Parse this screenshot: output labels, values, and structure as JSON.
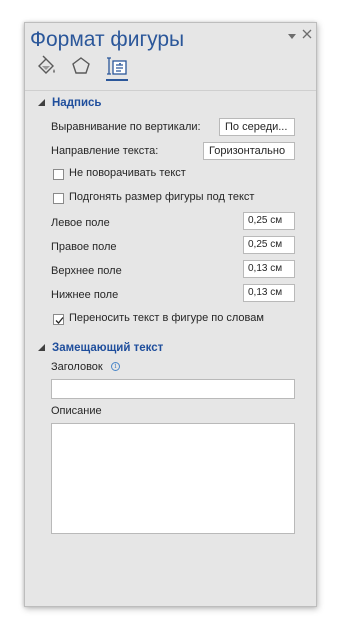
{
  "pane": {
    "title": "Формат фигуры"
  },
  "tabs": [
    {
      "name": "fill-line",
      "icon": "paint-bucket-icon"
    },
    {
      "name": "effects",
      "icon": "pentagon-icon"
    },
    {
      "name": "layout-properties",
      "icon": "text-box-layout-icon",
      "active": true
    }
  ],
  "sections": {
    "textbox": {
      "title": "Надпись",
      "vertical_alignment": {
        "label": "Выравнивание по вертикали:",
        "value": "По середи..."
      },
      "text_direction": {
        "label": "Направление текста:",
        "value": "Горизонтально"
      },
      "dont_rotate": {
        "label": "Не поворачивать текст",
        "checked": false
      },
      "resize_shape": {
        "label": "Подгонять размер фигуры под текст",
        "checked": false
      },
      "left_margin": {
        "label": "Левое поле",
        "value": "0,25 см"
      },
      "right_margin": {
        "label": "Правое поле",
        "value": "0,25 см"
      },
      "top_margin": {
        "label": "Верхнее поле",
        "value": "0,13 см"
      },
      "bottom_margin": {
        "label": "Нижнее поле",
        "value": "0,13 см"
      },
      "wrap_text": {
        "label": "Переносить текст в фигуре по словам",
        "checked": true
      }
    },
    "alt_text": {
      "title": "Замещающий текст",
      "title_field": {
        "label": "Заголовок",
        "value": ""
      },
      "description_field": {
        "label": "Описание",
        "value": ""
      }
    }
  },
  "colors": {
    "accent": "#2b579a",
    "pane_bg": "#e6e6e6",
    "section_title": "#1f4e9c"
  }
}
